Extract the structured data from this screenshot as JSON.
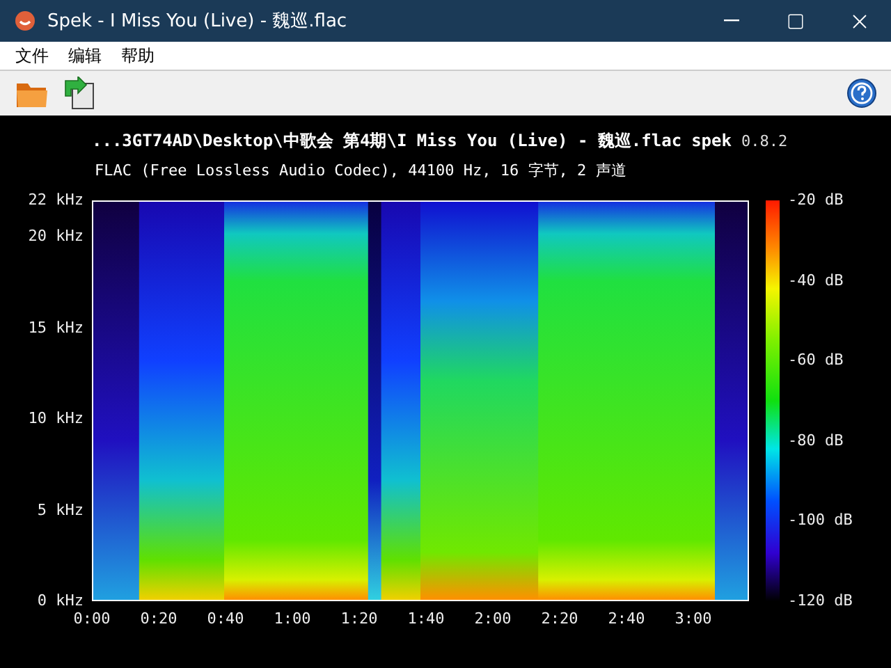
{
  "window": {
    "title": "Spek - I Miss You (Live) - 魏巡.flac"
  },
  "menu": [
    {
      "label": "文件"
    },
    {
      "label": "编辑"
    },
    {
      "label": "帮助"
    }
  ],
  "spectrum": {
    "file_path": "...3GT74AD\\Desktop\\中歌会 第4期\\I Miss You (Live) - 魏巡.flac",
    "app_name": "spek",
    "version": "0.8.2",
    "info": "FLAC (Free Lossless Audio Codec), 44100 Hz, 16 字节, 2 声道",
    "frequency_labels": [
      "22 kHz",
      "20 kHz",
      "15 kHz",
      "10 kHz",
      "5 kHz",
      "0 kHz"
    ],
    "time_labels": [
      "0:00",
      "0:20",
      "0:40",
      "1:00",
      "1:20",
      "1:40",
      "2:00",
      "2:20",
      "2:40",
      "3:00"
    ],
    "db_labels": [
      "-20 dB",
      "-40 dB",
      "-60 dB",
      "-80 dB",
      "-100 dB",
      "-120 dB"
    ]
  }
}
